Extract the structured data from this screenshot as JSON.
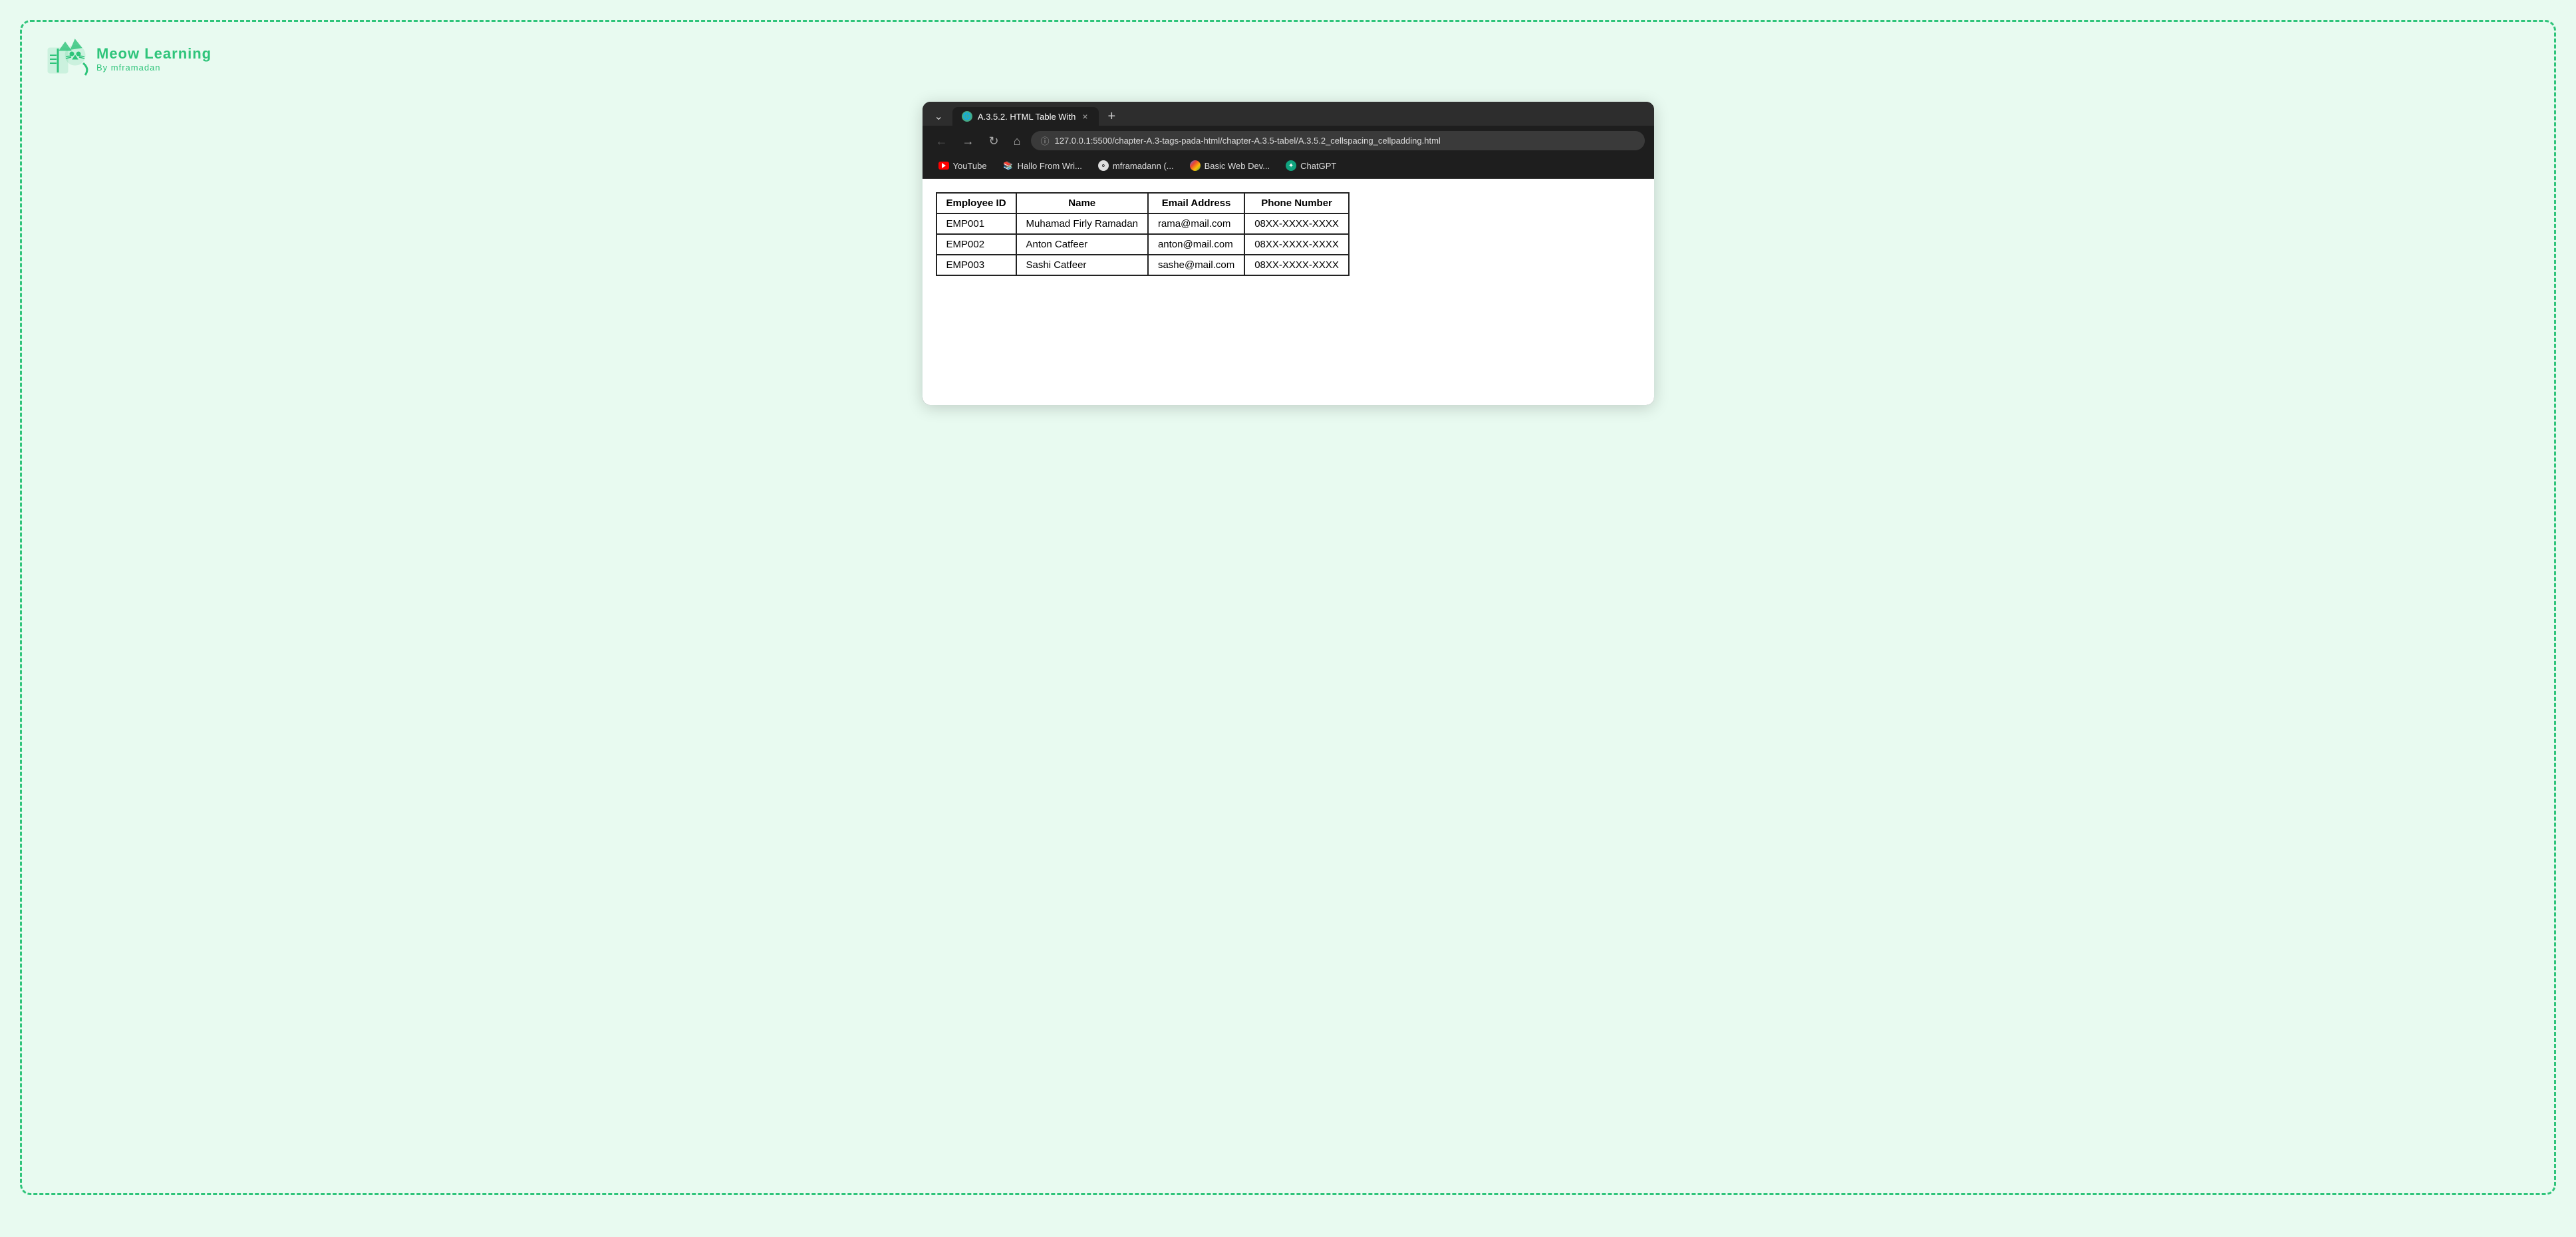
{
  "logo": {
    "title": "Meow Learning",
    "subtitle": "By mframadan"
  },
  "browser": {
    "tab": {
      "title": "A.3.5.2. HTML Table With",
      "favicon_label": "🌐"
    },
    "tab_close": "×",
    "tab_new": "+",
    "nav": {
      "back": "←",
      "forward": "→",
      "reload": "↻",
      "home": "⌂"
    },
    "address": "127.0.0.1:5500/chapter-A.3-tags-pada-html/chapter-A.3.5-tabel/A.3.5.2_cellspacing_cellpadding.html",
    "bookmarks": [
      {
        "id": "youtube",
        "label": "YouTube",
        "icon_type": "youtube"
      },
      {
        "id": "hallo",
        "label": "Hallo From Wri...",
        "icon_type": "hallo"
      },
      {
        "id": "github",
        "label": "mframadann (...",
        "icon_type": "github"
      },
      {
        "id": "basic",
        "label": "Basic Web Dev...",
        "icon_type": "basic"
      },
      {
        "id": "chatgpt",
        "label": "ChatGPT",
        "icon_type": "chatgpt"
      }
    ]
  },
  "table": {
    "headers": [
      "Employee ID",
      "Name",
      "Email Address",
      "Phone Number"
    ],
    "rows": [
      [
        "EMP001",
        "Muhamad Firly Ramadan",
        "rama@mail.com",
        "08XX-XXXX-XXXX"
      ],
      [
        "EMP002",
        "Anton Catfeer",
        "anton@mail.com",
        "08XX-XXXX-XXXX"
      ],
      [
        "EMP003",
        "Sashi Catfeer",
        "sashe@mail.com",
        "08XX-XXXX-XXXX"
      ]
    ]
  }
}
